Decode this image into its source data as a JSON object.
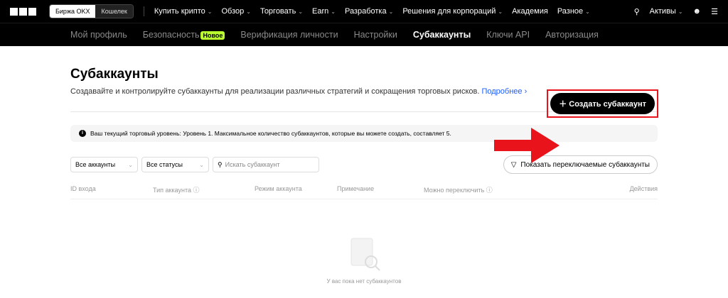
{
  "header": {
    "exchange_tab": "Биржа OKX",
    "wallet_tab": "Кошелек",
    "nav": [
      "Купить крипто",
      "Обзор",
      "Торговать",
      "Earn",
      "Разработка",
      "Решения для корпораций",
      "Академия",
      "Разное"
    ],
    "nav_chevron": [
      true,
      true,
      true,
      true,
      true,
      true,
      false,
      true
    ],
    "assets": "Активы"
  },
  "subnav": {
    "items": [
      "Мой профиль",
      "Безопасность",
      "Верификация личности",
      "Настройки",
      "Субаккаунты",
      "Ключи API",
      "Авторизация"
    ],
    "badge": "Новое"
  },
  "page": {
    "title": "Субаккаунты",
    "description": "Создавайте и контролируйте субаккаунты для реализации различных стратегий и сокращения торговых рисков.",
    "learn_more": "Подробнее",
    "create_button": "Создать субаккаунт",
    "info": "Ваш текущий торговый уровень: Уровень 1. Максимальное количество субаккаунтов, которые вы можете создать, составляет 5."
  },
  "filters": {
    "accounts": "Все аккаунты",
    "statuses": "Все статусы",
    "search_placeholder": "Искать субаккаунт",
    "show_switchable": "Показать переключаемые субаккаунты"
  },
  "table": {
    "columns": [
      "ID входа",
      "Тип аккаунта ⓘ",
      "Режим аккаунта",
      "Примечание",
      "Можно переключить ⓘ",
      "Действия"
    ]
  },
  "empty": "У вас пока нет субаккаунтов",
  "colors": {
    "accent": "#bcff2f",
    "highlight": "#e8131b",
    "link": "#1a5cff"
  }
}
